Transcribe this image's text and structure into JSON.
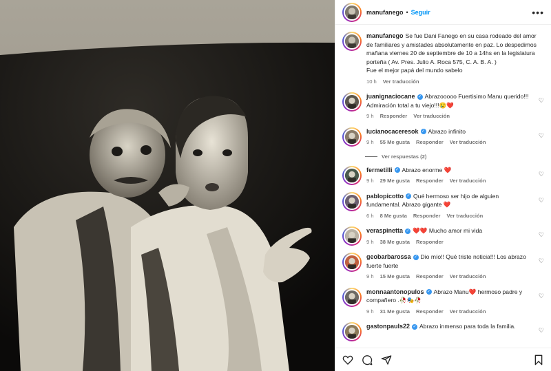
{
  "post": {
    "author": "manufanego",
    "follow_label": "Seguir",
    "separator": "•",
    "more": "•••"
  },
  "caption": {
    "username": "manufanego",
    "text": "Se fue Dani Fanego en su casa rodeado del amor de familiares y amistades absolutamente en paz. Lo despedimos mañana viernes 20 de septiembre de 10 a 14hs en la legislatura porteña ( Av. Pres. Julio A. Roca 575, C. A. B. A. )",
    "text2": "Fue el mejor papá del mundo sabelo",
    "time": "10 h",
    "translate": "Ver traducción"
  },
  "comments": [
    {
      "username": "juanignaciocane",
      "verified": true,
      "text": "Abrazooooo Fuertisimo Manu querido!!! Admiración total a tu viejo!!!😢❤️",
      "time": "9 h",
      "likes": "",
      "reply": "Responder",
      "translate": "Ver traducción"
    },
    {
      "username": "lucianocaceresok",
      "verified": true,
      "text": "Abrazo infinito",
      "time": "9 h",
      "likes": "55 Me gusta",
      "reply": "Responder",
      "translate": "Ver traducción",
      "replies": "Ver respuestas (2)"
    },
    {
      "username": "fermetilli",
      "verified": true,
      "text": "Abrazo enorme ❤️",
      "time": "9 h",
      "likes": "29 Me gusta",
      "reply": "Responder",
      "translate": "Ver traducción"
    },
    {
      "username": "pablopicotto",
      "verified": true,
      "text": "Qué hermoso ser hijo de alguien fundamental. Abrazo gigante ❤️",
      "time": "6 h",
      "likes": "8 Me gusta",
      "reply": "Responder",
      "translate": "Ver traducción"
    },
    {
      "username": "veraspinetta",
      "verified": true,
      "text": "❤️❤️ Mucho amor mi vida",
      "time": "9 h",
      "likes": "38 Me gusta",
      "reply": "Responder",
      "translate": ""
    },
    {
      "username": "geobarbarossa",
      "verified": true,
      "text": "Dio mío!! Qué triste noticia!!! Los abrazo fuerte fuerte",
      "time": "9 h",
      "likes": "15 Me gusta",
      "reply": "Responder",
      "translate": "Ver traducción"
    },
    {
      "username": "monnaantonopulos",
      "verified": true,
      "text": "Abrazo Manu❤️ hermoso padre y compañero .🥀🎭🥀",
      "time": "9 h",
      "likes": "31 Me gusta",
      "reply": "Responder",
      "translate": "Ver traducción"
    },
    {
      "username": "gastonpauls22",
      "verified": true,
      "text": "Abrazo inmenso para toda la familia.",
      "time": "",
      "likes": "",
      "reply": "",
      "translate": ""
    }
  ],
  "icons": {
    "like": "heart-outline-icon",
    "comment": "comment-icon",
    "share": "share-icon",
    "save": "bookmark-icon"
  }
}
